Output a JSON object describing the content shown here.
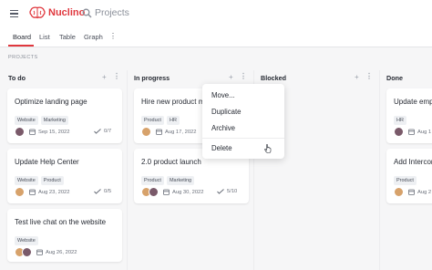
{
  "app": {
    "name": "Nuclino",
    "breadcrumb": "Projects",
    "section_label": "PROJECTS"
  },
  "tabs": [
    {
      "label": "Board",
      "active": true
    },
    {
      "label": "List"
    },
    {
      "label": "Table"
    },
    {
      "label": "Graph"
    }
  ],
  "columns": [
    {
      "title": "To do",
      "cards": [
        {
          "title": "Optimize landing page",
          "tags": [
            "Website",
            "Marketing"
          ],
          "date": "Sep 15, 2022",
          "progress": "0/7"
        },
        {
          "title": "Update Help Center",
          "tags": [
            "Website",
            "Product"
          ],
          "date": "Aug 23, 2022",
          "progress": "0/5"
        },
        {
          "title": "Test live chat on the website",
          "tags": [
            "Website"
          ],
          "date": "Aug 26, 2022",
          "progress": ""
        }
      ]
    },
    {
      "title": "In progress",
      "cards": [
        {
          "title": "Hire new product ma",
          "tags": [
            "Product",
            "HR"
          ],
          "date": "Aug 17, 2022",
          "progress": ""
        },
        {
          "title": "2.0 product launch",
          "tags": [
            "Product",
            "Marketing"
          ],
          "date": "Aug 30, 2022",
          "progress": "5/10"
        }
      ]
    },
    {
      "title": "Blocked",
      "cards": []
    },
    {
      "title": "Done",
      "cards": [
        {
          "title": "Update empl",
          "tags": [
            "HR"
          ],
          "date": "Aug 1",
          "progress": ""
        },
        {
          "title": "Add Intercom",
          "tags": [
            "Product"
          ],
          "date": "Aug 2",
          "progress": ""
        }
      ]
    }
  ],
  "context_menu": {
    "items": [
      "Move...",
      "Duplicate",
      "Archive",
      "Delete"
    ]
  },
  "colors": {
    "brand": "#e0383e",
    "background": "#f6f6f7",
    "card": "#ffffff"
  }
}
